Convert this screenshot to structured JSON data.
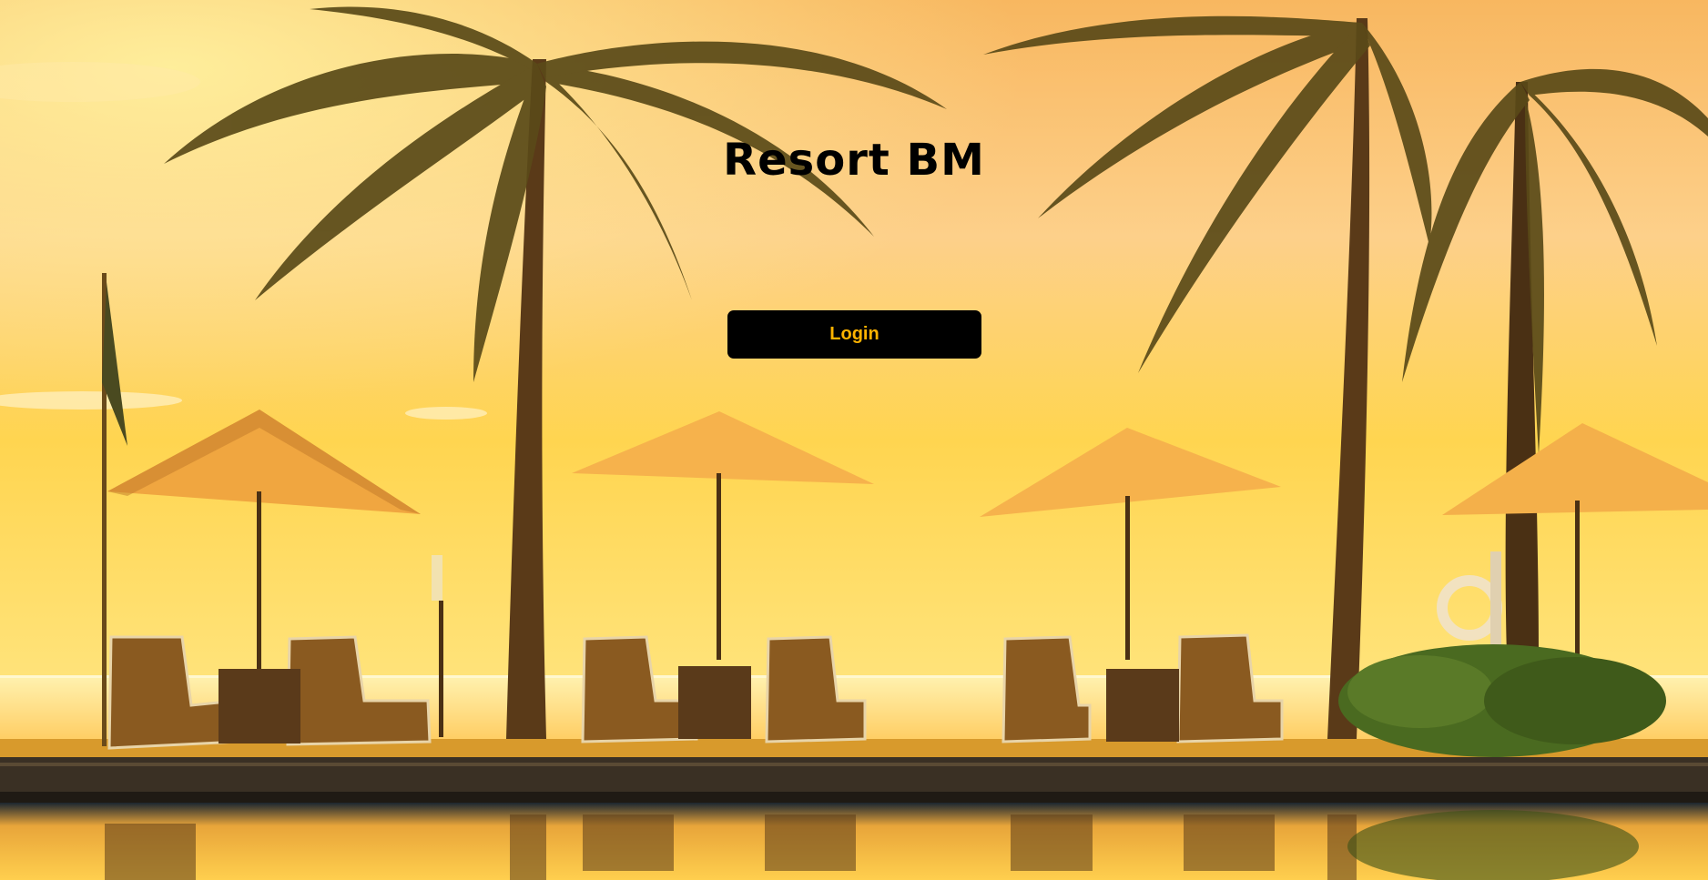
{
  "header": {
    "title": "Resort BM"
  },
  "login": {
    "label": "Login"
  },
  "colors": {
    "button_bg": "#000000",
    "button_text": "#ffb300",
    "sky_top": "#fbc27a",
    "sky_bottom": "#ffd84a",
    "deck": "#3a3024"
  },
  "background": {
    "icon": "beach-resort-photo"
  }
}
